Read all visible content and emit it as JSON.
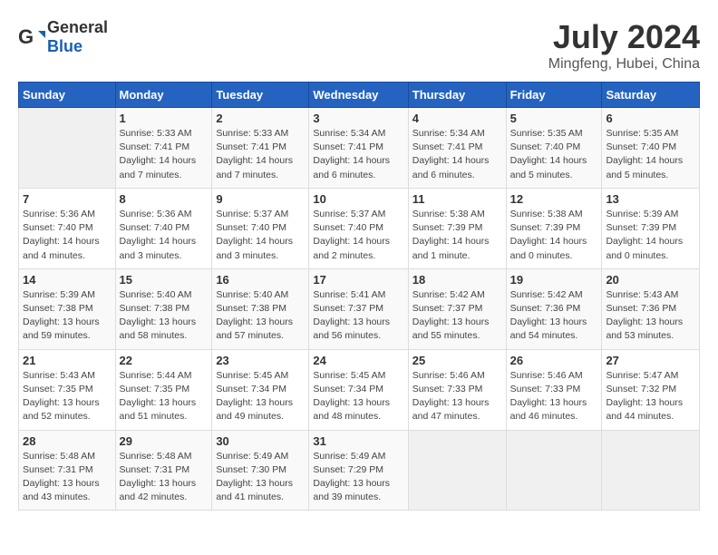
{
  "header": {
    "logo_general": "General",
    "logo_blue": "Blue",
    "title": "July 2024",
    "location": "Mingfeng, Hubei, China"
  },
  "columns": [
    "Sunday",
    "Monday",
    "Tuesday",
    "Wednesday",
    "Thursday",
    "Friday",
    "Saturday"
  ],
  "weeks": [
    [
      {
        "day": "",
        "sunrise": "",
        "sunset": "",
        "daylight": ""
      },
      {
        "day": "1",
        "sunrise": "Sunrise: 5:33 AM",
        "sunset": "Sunset: 7:41 PM",
        "daylight": "Daylight: 14 hours and 7 minutes."
      },
      {
        "day": "2",
        "sunrise": "Sunrise: 5:33 AM",
        "sunset": "Sunset: 7:41 PM",
        "daylight": "Daylight: 14 hours and 7 minutes."
      },
      {
        "day": "3",
        "sunrise": "Sunrise: 5:34 AM",
        "sunset": "Sunset: 7:41 PM",
        "daylight": "Daylight: 14 hours and 6 minutes."
      },
      {
        "day": "4",
        "sunrise": "Sunrise: 5:34 AM",
        "sunset": "Sunset: 7:41 PM",
        "daylight": "Daylight: 14 hours and 6 minutes."
      },
      {
        "day": "5",
        "sunrise": "Sunrise: 5:35 AM",
        "sunset": "Sunset: 7:40 PM",
        "daylight": "Daylight: 14 hours and 5 minutes."
      },
      {
        "day": "6",
        "sunrise": "Sunrise: 5:35 AM",
        "sunset": "Sunset: 7:40 PM",
        "daylight": "Daylight: 14 hours and 5 minutes."
      }
    ],
    [
      {
        "day": "7",
        "sunrise": "Sunrise: 5:36 AM",
        "sunset": "Sunset: 7:40 PM",
        "daylight": "Daylight: 14 hours and 4 minutes."
      },
      {
        "day": "8",
        "sunrise": "Sunrise: 5:36 AM",
        "sunset": "Sunset: 7:40 PM",
        "daylight": "Daylight: 14 hours and 3 minutes."
      },
      {
        "day": "9",
        "sunrise": "Sunrise: 5:37 AM",
        "sunset": "Sunset: 7:40 PM",
        "daylight": "Daylight: 14 hours and 3 minutes."
      },
      {
        "day": "10",
        "sunrise": "Sunrise: 5:37 AM",
        "sunset": "Sunset: 7:40 PM",
        "daylight": "Daylight: 14 hours and 2 minutes."
      },
      {
        "day": "11",
        "sunrise": "Sunrise: 5:38 AM",
        "sunset": "Sunset: 7:39 PM",
        "daylight": "Daylight: 14 hours and 1 minute."
      },
      {
        "day": "12",
        "sunrise": "Sunrise: 5:38 AM",
        "sunset": "Sunset: 7:39 PM",
        "daylight": "Daylight: 14 hours and 0 minutes."
      },
      {
        "day": "13",
        "sunrise": "Sunrise: 5:39 AM",
        "sunset": "Sunset: 7:39 PM",
        "daylight": "Daylight: 14 hours and 0 minutes."
      }
    ],
    [
      {
        "day": "14",
        "sunrise": "Sunrise: 5:39 AM",
        "sunset": "Sunset: 7:38 PM",
        "daylight": "Daylight: 13 hours and 59 minutes."
      },
      {
        "day": "15",
        "sunrise": "Sunrise: 5:40 AM",
        "sunset": "Sunset: 7:38 PM",
        "daylight": "Daylight: 13 hours and 58 minutes."
      },
      {
        "day": "16",
        "sunrise": "Sunrise: 5:40 AM",
        "sunset": "Sunset: 7:38 PM",
        "daylight": "Daylight: 13 hours and 57 minutes."
      },
      {
        "day": "17",
        "sunrise": "Sunrise: 5:41 AM",
        "sunset": "Sunset: 7:37 PM",
        "daylight": "Daylight: 13 hours and 56 minutes."
      },
      {
        "day": "18",
        "sunrise": "Sunrise: 5:42 AM",
        "sunset": "Sunset: 7:37 PM",
        "daylight": "Daylight: 13 hours and 55 minutes."
      },
      {
        "day": "19",
        "sunrise": "Sunrise: 5:42 AM",
        "sunset": "Sunset: 7:36 PM",
        "daylight": "Daylight: 13 hours and 54 minutes."
      },
      {
        "day": "20",
        "sunrise": "Sunrise: 5:43 AM",
        "sunset": "Sunset: 7:36 PM",
        "daylight": "Daylight: 13 hours and 53 minutes."
      }
    ],
    [
      {
        "day": "21",
        "sunrise": "Sunrise: 5:43 AM",
        "sunset": "Sunset: 7:35 PM",
        "daylight": "Daylight: 13 hours and 52 minutes."
      },
      {
        "day": "22",
        "sunrise": "Sunrise: 5:44 AM",
        "sunset": "Sunset: 7:35 PM",
        "daylight": "Daylight: 13 hours and 51 minutes."
      },
      {
        "day": "23",
        "sunrise": "Sunrise: 5:45 AM",
        "sunset": "Sunset: 7:34 PM",
        "daylight": "Daylight: 13 hours and 49 minutes."
      },
      {
        "day": "24",
        "sunrise": "Sunrise: 5:45 AM",
        "sunset": "Sunset: 7:34 PM",
        "daylight": "Daylight: 13 hours and 48 minutes."
      },
      {
        "day": "25",
        "sunrise": "Sunrise: 5:46 AM",
        "sunset": "Sunset: 7:33 PM",
        "daylight": "Daylight: 13 hours and 47 minutes."
      },
      {
        "day": "26",
        "sunrise": "Sunrise: 5:46 AM",
        "sunset": "Sunset: 7:33 PM",
        "daylight": "Daylight: 13 hours and 46 minutes."
      },
      {
        "day": "27",
        "sunrise": "Sunrise: 5:47 AM",
        "sunset": "Sunset: 7:32 PM",
        "daylight": "Daylight: 13 hours and 44 minutes."
      }
    ],
    [
      {
        "day": "28",
        "sunrise": "Sunrise: 5:48 AM",
        "sunset": "Sunset: 7:31 PM",
        "daylight": "Daylight: 13 hours and 43 minutes."
      },
      {
        "day": "29",
        "sunrise": "Sunrise: 5:48 AM",
        "sunset": "Sunset: 7:31 PM",
        "daylight": "Daylight: 13 hours and 42 minutes."
      },
      {
        "day": "30",
        "sunrise": "Sunrise: 5:49 AM",
        "sunset": "Sunset: 7:30 PM",
        "daylight": "Daylight: 13 hours and 41 minutes."
      },
      {
        "day": "31",
        "sunrise": "Sunrise: 5:49 AM",
        "sunset": "Sunset: 7:29 PM",
        "daylight": "Daylight: 13 hours and 39 minutes."
      },
      {
        "day": "",
        "sunrise": "",
        "sunset": "",
        "daylight": ""
      },
      {
        "day": "",
        "sunrise": "",
        "sunset": "",
        "daylight": ""
      },
      {
        "day": "",
        "sunrise": "",
        "sunset": "",
        "daylight": ""
      }
    ]
  ]
}
